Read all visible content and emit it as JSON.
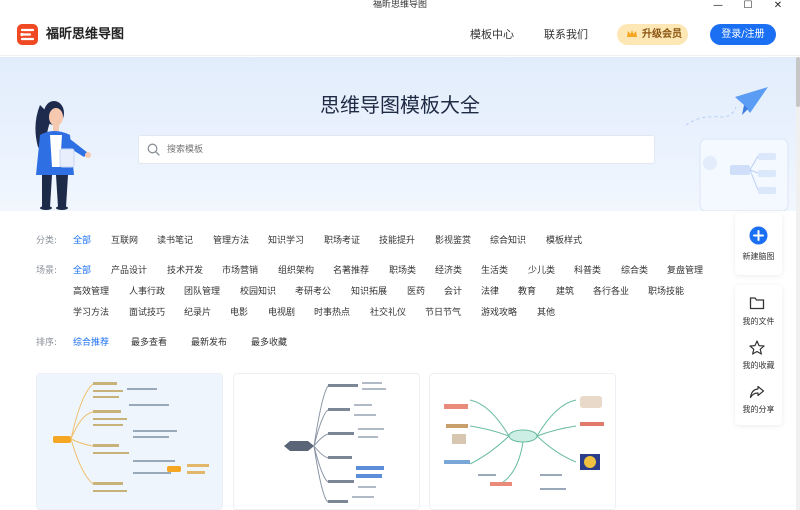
{
  "window": {
    "title": "福昕思维导图",
    "controls": [
      "minimize-icon",
      "maximize-icon",
      "close-icon"
    ]
  },
  "header": {
    "app_name": "福昕思维导图",
    "nav": [
      "模板中心",
      "联系我们"
    ],
    "vip_label": "升级会员",
    "login_label": "登录/注册"
  },
  "hero": {
    "title": "思维导图模板大全",
    "search_placeholder": "搜索模板"
  },
  "filters": {
    "category": {
      "label": "分类:",
      "items": [
        "全部",
        "互联网",
        "读书笔记",
        "管理方法",
        "知识学习",
        "职场考证",
        "技能提升",
        "影视鉴赏",
        "综合知识",
        "模板样式"
      ],
      "active": "全部"
    },
    "scene": {
      "label": "场景:",
      "rows": [
        [
          "全部",
          "产品设计",
          "技术开发",
          "市场营销",
          "组织架构",
          "名著推荐",
          "职场类",
          "经济类",
          "生活类",
          "少儿类",
          "科普类",
          "综合类",
          "复盘管理"
        ],
        [
          "高效管理",
          "人事行政",
          "团队管理",
          "校园知识",
          "考研考公",
          "知识拓展",
          "医药",
          "会计",
          "法律",
          "教育",
          "建筑",
          "各行各业",
          "职场技能"
        ],
        [
          "学习方法",
          "面试技巧",
          "纪录片",
          "电影",
          "电视剧",
          "时事热点",
          "社交礼仪",
          "节日节气",
          "游戏攻略",
          "其他"
        ]
      ],
      "active": "全部"
    },
    "sort": {
      "label": "排序:",
      "items": [
        "综合推荐",
        "最多查看",
        "最新发布",
        "最多收藏"
      ],
      "active": "综合推荐"
    }
  },
  "side_panel": {
    "new": {
      "label": "新建脑图",
      "icon": "plus-circle-icon"
    },
    "files": {
      "label": "我的文件",
      "icon": "folder-icon"
    },
    "favorites": {
      "label": "我的收藏",
      "icon": "star-icon"
    },
    "shares": {
      "label": "我的分享",
      "icon": "share-icon"
    }
  },
  "colors": {
    "accent": "#1a6ff2",
    "brand": "#f04a24",
    "vip_bg": "#fde7b4",
    "hero_bg": "#e6effc"
  }
}
